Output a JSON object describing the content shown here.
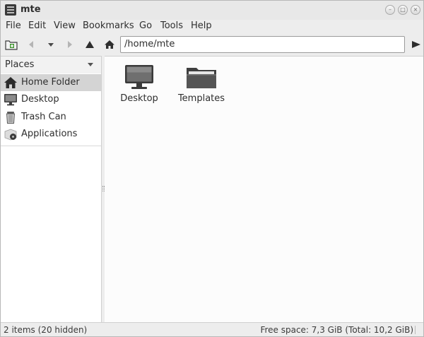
{
  "window": {
    "title": "mte",
    "controls": {
      "minimize": "–",
      "maximize": "□",
      "close": "×"
    }
  },
  "menu": [
    "File",
    "Edit",
    "View",
    "Bookmarks",
    "Go",
    "Tools",
    "Help"
  ],
  "toolbar": {
    "location": "/home/mte"
  },
  "sidebar": {
    "header": "Places",
    "items": [
      {
        "label": "Home Folder",
        "icon": "home-icon",
        "selected": true
      },
      {
        "label": "Desktop",
        "icon": "monitor-icon",
        "selected": false
      },
      {
        "label": "Trash Can",
        "icon": "trash-icon",
        "selected": false
      },
      {
        "label": "Applications",
        "icon": "applications-icon",
        "selected": false
      }
    ]
  },
  "files": [
    {
      "name": "Desktop",
      "icon": "monitor-icon"
    },
    {
      "name": "Templates",
      "icon": "folder-icon"
    }
  ],
  "status": {
    "left": "2 items (20 hidden)",
    "right": "Free space: 7,3 GiB (Total: 10,2 GiB)"
  },
  "colors": {
    "selected_bg": "#d4d4d4",
    "content_bg": "#fcfcfc",
    "chrome_bg": "#ededed"
  }
}
